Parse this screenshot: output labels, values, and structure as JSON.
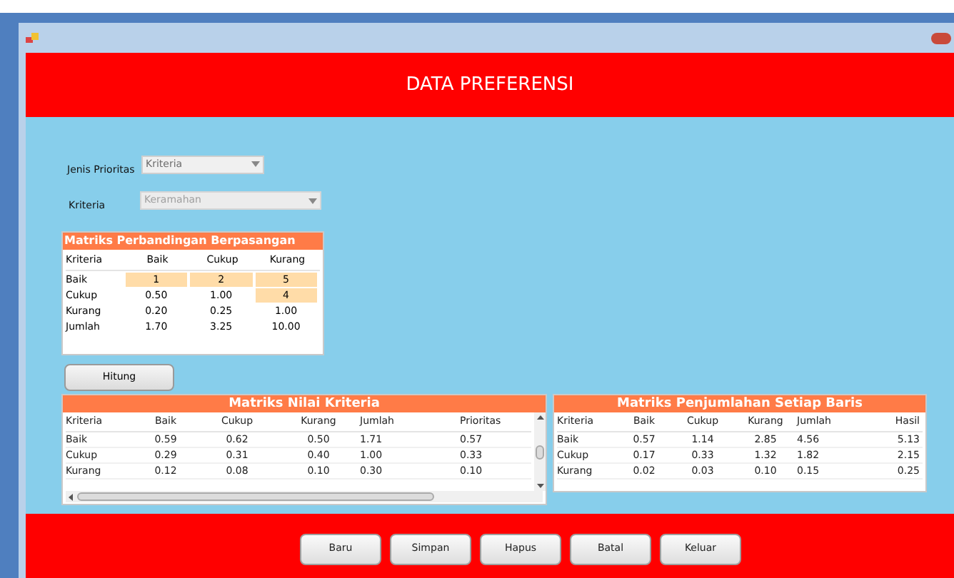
{
  "window": {
    "title": "DATA PREFERENSI"
  },
  "form": {
    "jenis_prioritas": {
      "label": "Jenis Prioritas",
      "value": "Kriteria",
      "disabled": false
    },
    "kriteria": {
      "label": "Kriteria",
      "value": "Keramahan",
      "disabled": true
    }
  },
  "matriks_perbandingan": {
    "title": "Matriks Perbandingan Berpasangan",
    "columns": [
      "Kriteria",
      "Baik",
      "Cukup",
      "Kurang"
    ],
    "rows": [
      [
        {
          "text": "Baik",
          "editable": false
        },
        {
          "text": "1",
          "editable": true
        },
        {
          "text": "2",
          "editable": true
        },
        {
          "text": "5",
          "editable": true
        }
      ],
      [
        {
          "text": "Cukup",
          "editable": false
        },
        {
          "text": "0.50",
          "editable": false
        },
        {
          "text": "1.00",
          "editable": false
        },
        {
          "text": "4",
          "editable": true
        }
      ],
      [
        {
          "text": "Kurang",
          "editable": false
        },
        {
          "text": "0.20",
          "editable": false
        },
        {
          "text": "0.25",
          "editable": false
        },
        {
          "text": "1.00",
          "editable": false
        }
      ],
      [
        {
          "text": "Jumlah",
          "editable": false
        },
        {
          "text": "1.70",
          "editable": false
        },
        {
          "text": "3.25",
          "editable": false
        },
        {
          "text": "10.00",
          "editable": false
        }
      ]
    ]
  },
  "hitung_button": "Hitung",
  "matriks_nilai": {
    "title": "Matriks Nilai Kriteria",
    "columns": [
      "Kriteria",
      "Baik",
      "Cukup",
      "Kurang",
      "Jumlah",
      "Prioritas"
    ],
    "rows": [
      [
        "Baik",
        "0.59",
        "0.62",
        "0.50",
        "1.71",
        "0.57"
      ],
      [
        "Cukup",
        "0.29",
        "0.31",
        "0.40",
        "1.00",
        "0.33"
      ],
      [
        "Kurang",
        "0.12",
        "0.08",
        "0.10",
        "0.30",
        "0.10"
      ]
    ]
  },
  "matriks_penjumlahan": {
    "title": "Matriks Penjumlahan Setiap Baris",
    "columns": [
      "Kriteria",
      "Baik",
      "Cukup",
      "Kurang",
      "Jumlah",
      "Hasil"
    ],
    "rows": [
      [
        "Baik",
        "0.57",
        "1.14",
        "2.85",
        "4.56",
        "5.13"
      ],
      [
        "Cukup",
        "0.17",
        "0.33",
        "1.32",
        "1.82",
        "2.15"
      ],
      [
        "Kurang",
        "0.02",
        "0.03",
        "0.10",
        "0.15",
        "0.25"
      ]
    ]
  },
  "buttons": [
    "Baru",
    "Simpan",
    "Hapus",
    "Batal",
    "Keluar"
  ]
}
